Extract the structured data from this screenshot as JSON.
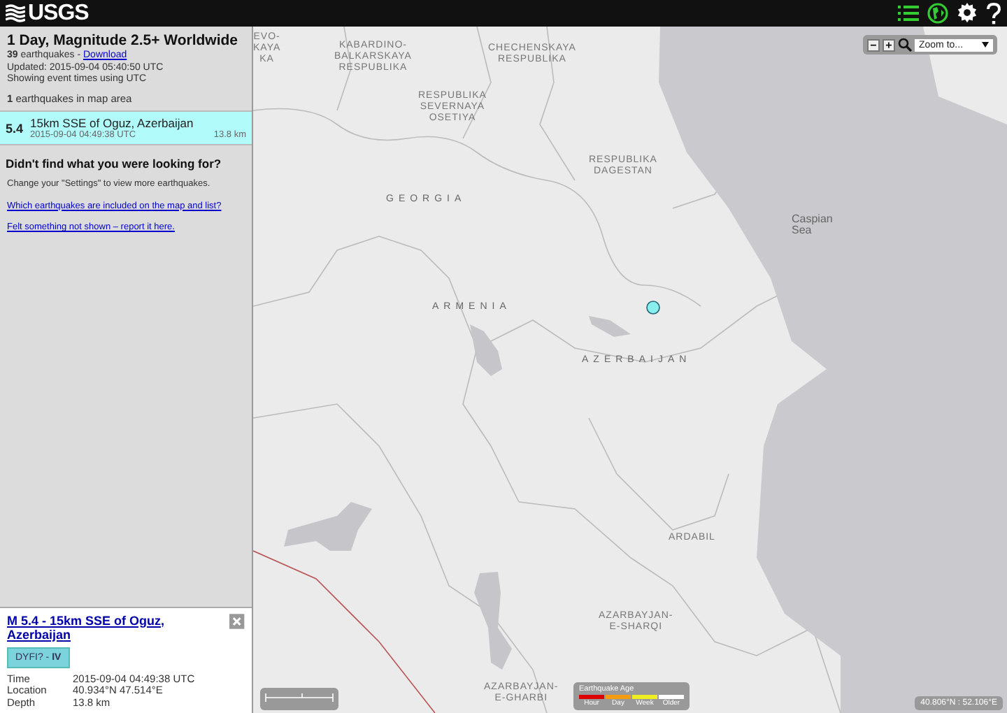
{
  "header": {
    "logo": "USGS",
    "tools": [
      {
        "kind": "list",
        "selected": true
      },
      {
        "kind": "globe",
        "selected": true
      },
      {
        "kind": "settings",
        "selected": false
      },
      {
        "kind": "help",
        "selected": false
      }
    ]
  },
  "sidebar": {
    "title": "1 Day, Magnitude 2.5+ Worldwide",
    "count": "**39** earthquakes - ",
    "download": "Download",
    "updated": "Updated: 2015-09-04 05:40:50 UTC",
    "time_note": "Showing event times using UTC",
    "map_count": "**1** earthquakes in map area",
    "events": [
      {
        "magnitude": "5.4",
        "place": "15km SSE of Oguz, Azerbaijan",
        "time": "2015-09-04 04:49:38 UTC",
        "depth": "13.8 km",
        "selected": true
      }
    ],
    "help_heading": "Didn't find what you were looking for?",
    "help_text": "Change your \"Settings\" to view more earthquakes.",
    "help_links": [
      "Which earthquakes are included on the map and list?",
      "Felt something not shown – report it here."
    ]
  },
  "detail": {
    "title": "M 5.4 - 15km SSE of Oguz, Azerbaijan",
    "dyfi": "DYFI? - ",
    "intensity": "IV",
    "fields": [
      {
        "label": "Time",
        "value": "2015-09-04 04:49:38 UTC"
      },
      {
        "label": "Location",
        "value": "40.934°N 47.514°E"
      },
      {
        "label": "Depth",
        "value": "13.8 km"
      }
    ]
  },
  "map": {
    "labels": [
      {
        "kind": "region",
        "text": "EVO-\nKAYA\nKA"
      },
      {
        "kind": "region",
        "text": "KABARDINO-\nBALKARSKAYA\nRESPUBLIKA"
      },
      {
        "kind": "region",
        "text": "CHECHENSKAYA\nRESPUBLIKA"
      },
      {
        "kind": "region",
        "text": "RESPUBLIKA\nSEVERNAYA\nOSETIYA"
      },
      {
        "kind": "region",
        "text": "RESPUBLIKA\nDAGESTAN"
      },
      {
        "kind": "country",
        "text": "GEORGIA"
      },
      {
        "kind": "sea",
        "text": "Caspian\nSea"
      },
      {
        "kind": "country",
        "text": "ARMENIA"
      },
      {
        "kind": "country",
        "text": "AZERBAIJAN"
      },
      {
        "kind": "region",
        "text": "ARDABIL"
      },
      {
        "kind": "region",
        "text": "AZARBAYJAN-\nE-SHARQI"
      },
      {
        "kind": "region",
        "text": "AZARBAYJAN-\nE-GHARBI"
      }
    ],
    "zoom_buttons": [
      "−",
      "+"
    ],
    "zoom_select": "Zoom to...",
    "legend": {
      "title": "Earthquake Age",
      "items": [
        {
          "label": "Hour",
          "color": "#dd0000"
        },
        {
          "label": "Day",
          "color": "#f39c12"
        },
        {
          "label": "Week",
          "color": "#eeee22"
        },
        {
          "label": "Older",
          "color": "#ffffff"
        }
      ]
    },
    "coordinates": "40.806°N : 52.106°E"
  }
}
